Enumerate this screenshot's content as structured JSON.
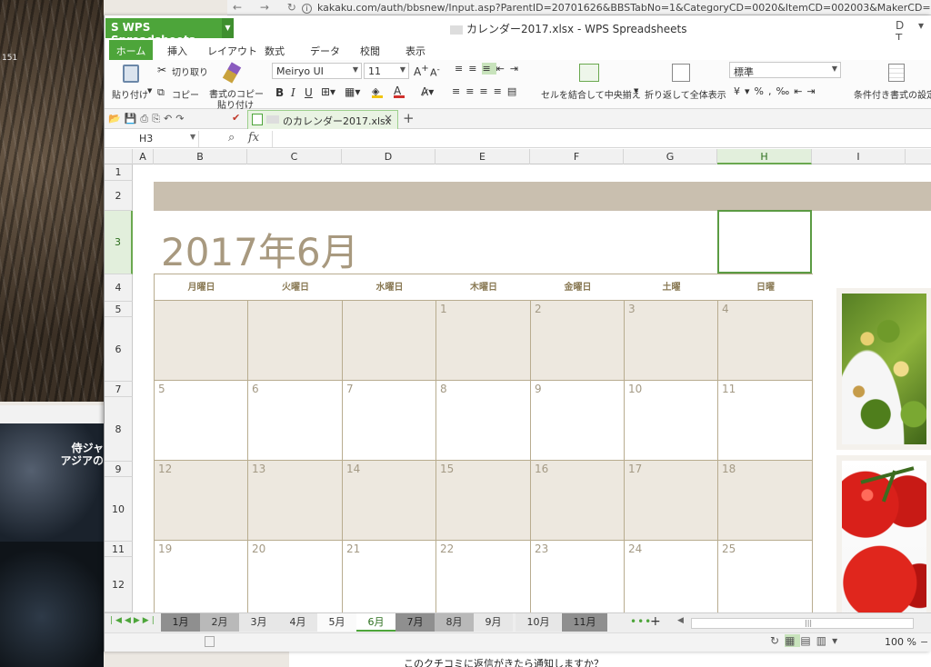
{
  "desktop": {
    "bark_text": "151",
    "news_caption": "侍ジャ アジアの"
  },
  "browser": {
    "nav": "← → ↻",
    "url": "kakaku.com/auth/bbsnew/Input.asp?ParentID=20701626&BBSTabNo=1&CategoryCD=0020&ItemCD=002003&MakerCD=35&Sor",
    "page_bottom_text": "このクチコミに返信がきたら通知しますか？"
  },
  "app": {
    "app_button": "WPS Spreadsheets",
    "document_title": "カレンダー2017.xlsx - WPS Spreadsheets",
    "tabs": [
      "ホーム",
      "挿入",
      "レイアウト",
      "数式",
      "データ",
      "校閲",
      "表示"
    ]
  },
  "ribbon": {
    "paste": "貼り付け",
    "cut": "切り取り",
    "copy": "コピー",
    "format_painter_1": "書式のコピー",
    "format_painter_2": "貼り付け",
    "font_name": "Meiryo UI",
    "font_size": "11",
    "merge_center": "セルを結合して中央揃え",
    "wrap_text": "折り返して全体表示",
    "number_format": "標準",
    "conditional_format": "条件付き書式の設定",
    "bold": "B",
    "italic": "I",
    "underline": "U"
  },
  "doc_tab": {
    "name": "のカレンダー2017.xlsx"
  },
  "formula_bar": {
    "name_box": "H3",
    "fx": "fx",
    "content": ""
  },
  "sheet": {
    "columns": [
      "A",
      "B",
      "C",
      "D",
      "E",
      "F",
      "G",
      "H",
      "I"
    ],
    "selected_column": "H",
    "rows": [
      "1",
      "2",
      "3",
      "4",
      "5",
      "6",
      "7",
      "8",
      "9",
      "10",
      "11",
      "12"
    ],
    "selected_row": "3",
    "month_title": "2017年6月",
    "weekdays": [
      "月曜日",
      "火曜日",
      "水曜日",
      "木曜日",
      "金曜日",
      "土曜",
      "日曜"
    ],
    "weeks": [
      [
        "",
        "",
        "",
        "1",
        "2",
        "3",
        "4"
      ],
      [
        "5",
        "6",
        "7",
        "8",
        "9",
        "10",
        "11"
      ],
      [
        "12",
        "13",
        "14",
        "15",
        "16",
        "17",
        "18"
      ],
      [
        "19",
        "20",
        "21",
        "22",
        "23",
        "24",
        "25"
      ]
    ]
  },
  "sheet_tabs": [
    "1月",
    "2月",
    "3月",
    "4月",
    "5月",
    "6月",
    "7月",
    "8月",
    "9月",
    "10月",
    "11月"
  ],
  "active_sheet": "6月",
  "status": {
    "zoom": "100 %"
  },
  "colors": {
    "accent": "#4da53a",
    "calendar_text": "#a8997f",
    "calendar_band": "#c9bfaf",
    "shaded_week": "#ede8df"
  }
}
